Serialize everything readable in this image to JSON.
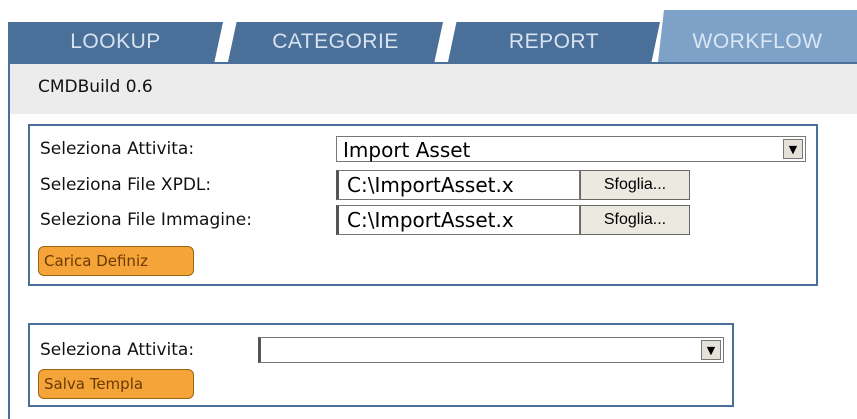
{
  "tabs": [
    {
      "label": "LOOKUP"
    },
    {
      "label": "CATEGORIE"
    },
    {
      "label": "REPORT"
    },
    {
      "label": "WORKFLOW",
      "active": true
    }
  ],
  "version": "CMDBuild 0.6",
  "form1": {
    "activity_label": "Seleziona Attivita:",
    "activity_value": "Import Asset",
    "xpdl_label": "Seleziona File XPDL:",
    "xpdl_value": "C:\\ImportAsset.x",
    "image_label": "Seleziona File Immagine:",
    "image_value": "C:\\ImportAsset.x",
    "browse_label": "Sfoglia...",
    "load_button": "Carica Definiz"
  },
  "form2": {
    "activity_label": "Seleziona Attivita:",
    "activity_value": "",
    "save_button": "Salva Templa"
  },
  "colors": {
    "tab": "#4a6f98",
    "tab_active": "#7ea2c7",
    "button_orange": "#f5a43a"
  }
}
